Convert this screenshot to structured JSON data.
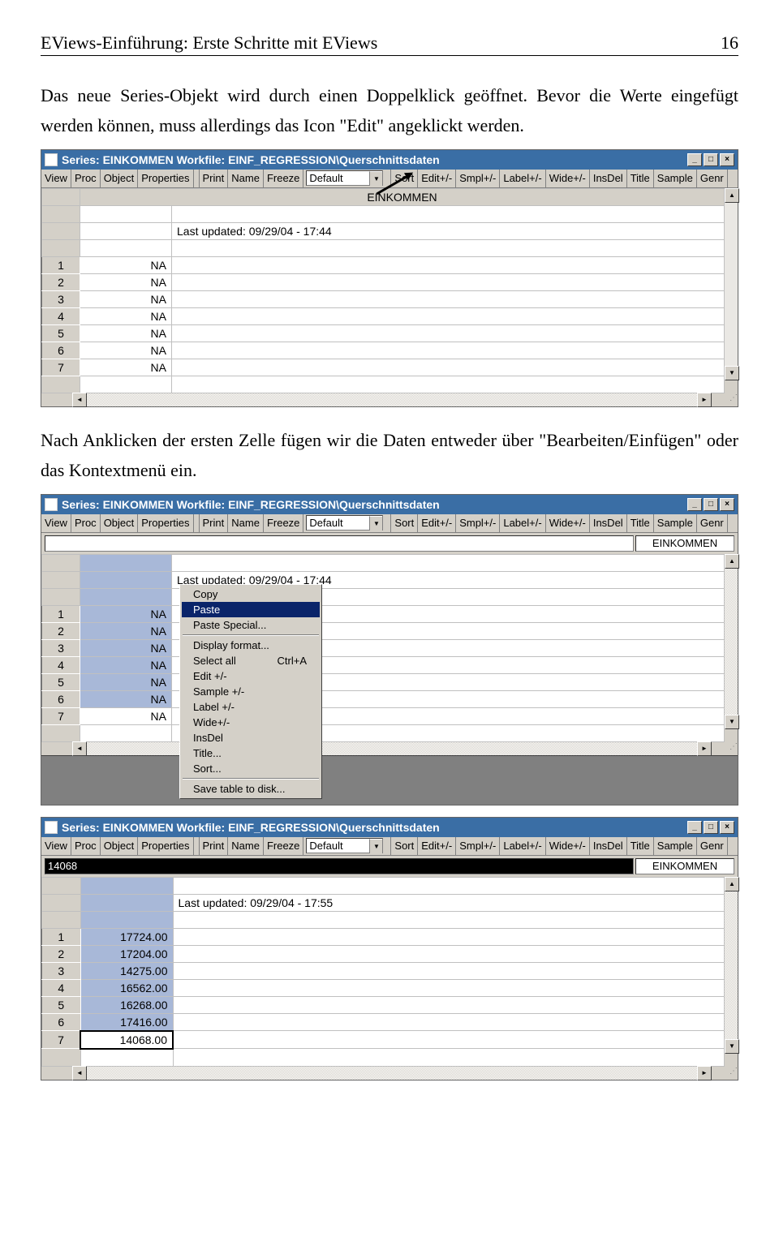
{
  "header": {
    "title": "EViews-Einführung: Erste Schritte mit EViews",
    "page": "16"
  },
  "para1": "Das neue Series-Objekt wird durch einen Doppelklick geöffnet. Bevor die Werte eingefügt werden können, muss allerdings das Icon \"Edit\" angeklickt werden.",
  "para2": "Nach Anklicken der ersten Zelle fügen wir die Daten entweder über \"Bearbeiten/Einfügen\" oder das Kontextmenü ein.",
  "win": {
    "title": "Series: EINKOMMEN   Workfile: EINF_REGRESSION\\Querschnittsdaten",
    "toolbar": [
      "View",
      "Proc",
      "Object",
      "Properties",
      "Print",
      "Name",
      "Freeze"
    ],
    "dropdown": "Default",
    "toolbar2": [
      "Sort",
      "Edit+/-",
      "Smpl+/-",
      "Label+/-",
      "Wide+/-",
      "InsDel",
      "Title",
      "Sample",
      "Genr"
    ],
    "colhdr": "EINKOMMEN",
    "updated1": "Last updated: 09/29/04 - 17:44",
    "updated2": "Last updated: 09/29/04 - 17:55",
    "na_rows": [
      {
        "n": "1",
        "v": "NA"
      },
      {
        "n": "2",
        "v": "NA"
      },
      {
        "n": "3",
        "v": "NA"
      },
      {
        "n": "4",
        "v": "NA"
      },
      {
        "n": "5",
        "v": "NA"
      },
      {
        "n": "6",
        "v": "NA"
      },
      {
        "n": "7",
        "v": "NA"
      }
    ],
    "val_rows": [
      {
        "n": "1",
        "v": "17724.00"
      },
      {
        "n": "2",
        "v": "17204.00"
      },
      {
        "n": "3",
        "v": "14275.00"
      },
      {
        "n": "4",
        "v": "16562.00"
      },
      {
        "n": "5",
        "v": "16268.00"
      },
      {
        "n": "6",
        "v": "17416.00"
      },
      {
        "n": "7",
        "v": "14068.00"
      }
    ],
    "edit_value": "14068"
  },
  "contextmenu": [
    {
      "label": "Copy",
      "sel": false
    },
    {
      "label": "Paste",
      "sel": true
    },
    {
      "label": "Paste Special...",
      "sel": false
    },
    {
      "sep": true
    },
    {
      "label": "Display format...",
      "sel": false
    },
    {
      "label": "Select all",
      "shortcut": "Ctrl+A",
      "sel": false
    },
    {
      "label": "Edit +/-",
      "sel": false
    },
    {
      "label": "Sample +/-",
      "sel": false
    },
    {
      "label": "Label +/-",
      "sel": false
    },
    {
      "label": "Wide+/-",
      "sel": false
    },
    {
      "label": "InsDel",
      "sel": false
    },
    {
      "label": "Title...",
      "sel": false
    },
    {
      "label": "Sort...",
      "sel": false
    },
    {
      "sep": true
    },
    {
      "label": "Save table to disk...",
      "sel": false
    }
  ],
  "winctrl": {
    "min": "_",
    "max": "□",
    "close": "×"
  }
}
